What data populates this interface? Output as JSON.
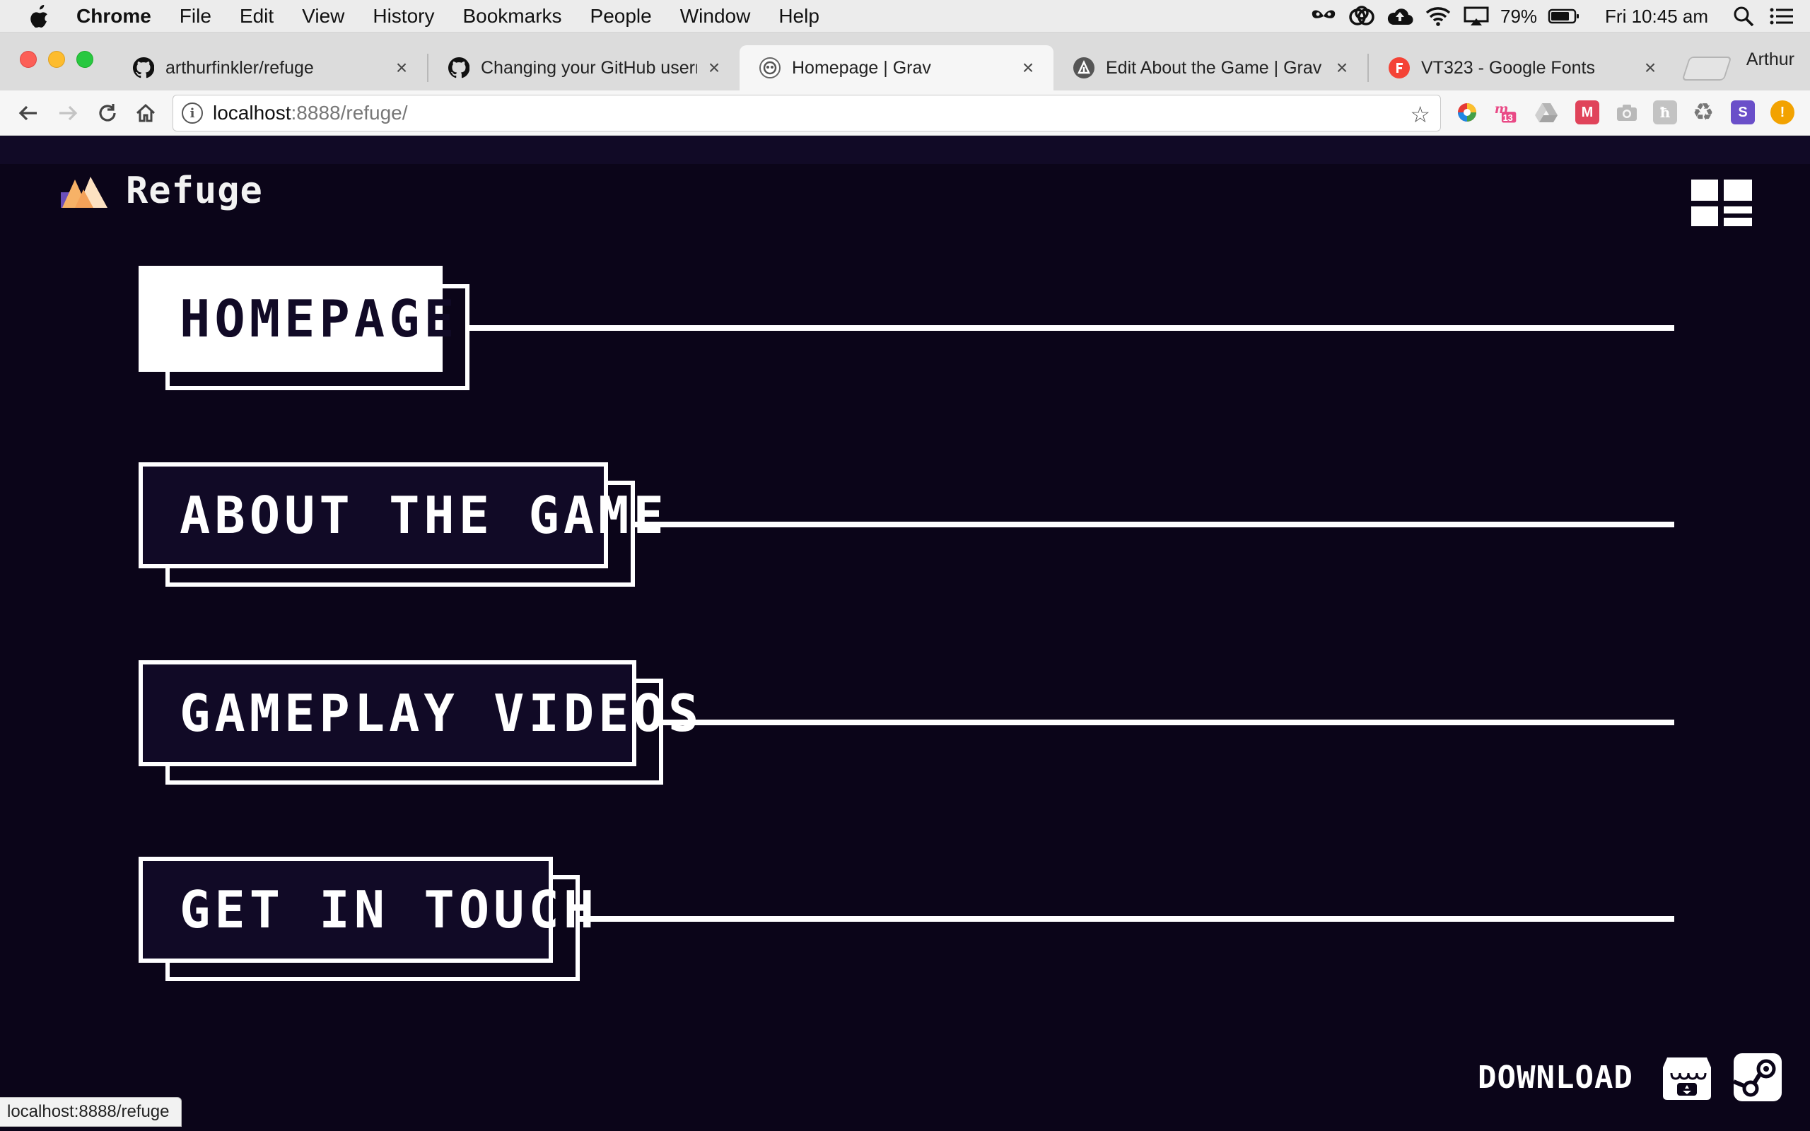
{
  "menubar": {
    "app": "Chrome",
    "items": [
      "File",
      "Edit",
      "View",
      "History",
      "Bookmarks",
      "People",
      "Window",
      "Help"
    ],
    "battery": "79%",
    "clock": "Fri 10:45 am",
    "status_icons": [
      "butterfly-icon",
      "creative-cloud-icon",
      "cloud-upload-icon",
      "wifi-icon",
      "airplay-icon",
      "battery-icon",
      "spotlight-search-icon",
      "notification-center-icon"
    ]
  },
  "browser": {
    "tabs": [
      {
        "title": "arthurfinkler/refuge",
        "icon": "github-icon"
      },
      {
        "title": "Changing your GitHub userna",
        "icon": "github-icon"
      },
      {
        "title": "Homepage | Grav",
        "icon": "grav-icon",
        "active": true
      },
      {
        "title": "Edit About the Game | Grav",
        "icon": "grav-admin-icon"
      },
      {
        "title": "VT323 - Google Fonts",
        "icon": "google-fonts-icon"
      }
    ],
    "profile": "Arthur",
    "url_host": "localhost",
    "url_path": ":8888/refuge/",
    "extensions": [
      "color-picker-extension",
      "calendar-extension",
      "drive-extension",
      "m-extension",
      "camera-extension",
      "h-extension",
      "recycle-extension",
      "s-extension",
      "alert-extension"
    ],
    "extension_badge": "13",
    "status_url": "localhost:8888/refuge"
  },
  "site": {
    "logo_text": "Refuge",
    "nav": [
      {
        "label": "HOMEPAGE",
        "active": true
      },
      {
        "label": "ABOUT THE GAME",
        "active": false
      },
      {
        "label": "GAMEPLAY VIDEOS",
        "active": false
      },
      {
        "label": "GET IN TOUCH",
        "active": false
      }
    ],
    "download_label": "DOWNLOAD",
    "stores": [
      "itch-io-icon",
      "steam-icon"
    ]
  },
  "colors": {
    "page_bg": "#0b0519",
    "accent": "#ffffff",
    "logo_peak_1": "#f7b267",
    "logo_peak_2": "#fde2c1",
    "logo_shadow": "#6b4fb8"
  }
}
